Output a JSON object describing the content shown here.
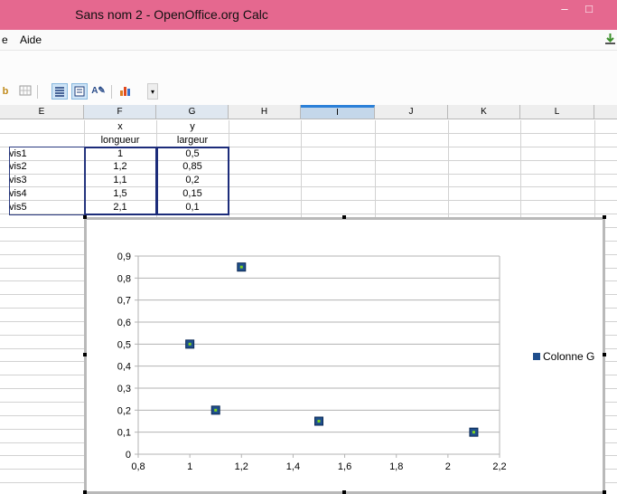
{
  "window": {
    "title": "Sans nom 2 - OpenOffice.org Calc",
    "minimize_glyph": "–",
    "maximize_glyph": "□"
  },
  "menu": {
    "items": [
      "e",
      "Aide"
    ]
  },
  "columns": [
    "E",
    "F",
    "G",
    "H",
    "I",
    "J",
    "K",
    "L"
  ],
  "rows": [
    {
      "e": "",
      "f": "x",
      "g": "y"
    },
    {
      "e": "",
      "f": "longueur",
      "g": "largeur"
    },
    {
      "e": "vis1",
      "f": "1",
      "g": "0,5"
    },
    {
      "e": "vis2",
      "f": "1,2",
      "g": "0,85"
    },
    {
      "e": "vis3",
      "f": "1,1",
      "g": "0,2"
    },
    {
      "e": "vis4",
      "f": "1,5",
      "g": "0,15"
    },
    {
      "e": "vis5",
      "f": "2,1",
      "g": "0,1"
    }
  ],
  "icons": [
    "toolbar-b-icon",
    "grid-icon",
    "align-left-icon",
    "list-icon",
    "text-format-icon",
    "chart-icon",
    "dropdown-arrow-icon",
    "download-icon"
  ],
  "colors": {
    "titlebar": "#e5688f",
    "marker": "#1f4e8c",
    "marker_center": "#7dd21f",
    "selection": "#1c2c7a"
  },
  "chart_data": {
    "type": "scatter",
    "points": [
      {
        "x": 1,
        "y": 0.5
      },
      {
        "x": 1.2,
        "y": 0.85
      },
      {
        "x": 1.1,
        "y": 0.2
      },
      {
        "x": 1.5,
        "y": 0.15
      },
      {
        "x": 2.1,
        "y": 0.1
      }
    ],
    "series": [
      {
        "name": "Colonne G"
      }
    ],
    "xlim": [
      0.8,
      2.2
    ],
    "ylim": [
      0,
      0.9
    ],
    "xticks": [
      "0,8",
      "1",
      "1,2",
      "1,4",
      "1,6",
      "1,8",
      "2",
      "2,2"
    ],
    "yticks": [
      "0",
      "0,1",
      "0,2",
      "0,3",
      "0,4",
      "0,5",
      "0,6",
      "0,7",
      "0,8",
      "0,9"
    ],
    "grid": "horizontal",
    "legend": "right"
  }
}
